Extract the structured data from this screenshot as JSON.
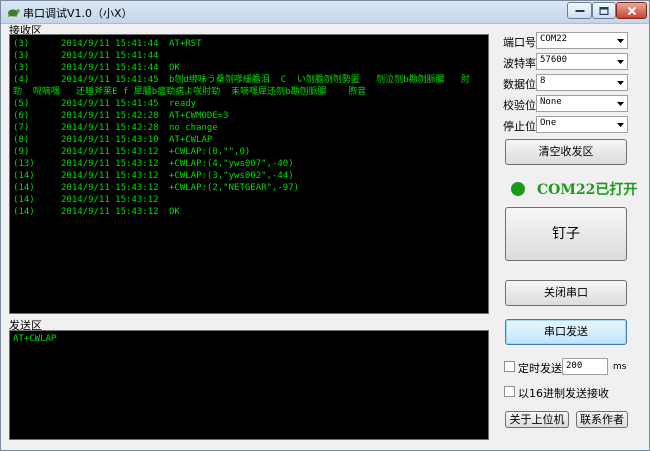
{
  "window": {
    "title": "串口调试V1.0（小X）"
  },
  "receive": {
    "label": "接收区",
    "lines": [
      {
        "seq": "(3)",
        "date": "2014/9/11 15:41:44",
        "text": "AT+RST"
      },
      {
        "seq": "(3)",
        "date": "2014/9/11 15:41:44",
        "text": ""
      },
      {
        "seq": "(3)",
        "date": "2014/9/11 15:41:44",
        "text": "OK"
      },
      {
        "seq": "(4)",
        "date": "2014/9/11 15:41:45",
        "text": "b刎d绑味う桑刎嗲緩膽泪  C  い刎膽刎刎勢匿   刎泣刎b勘刎脈膿   肘"
      },
      {
        "seq": "",
        "date": "",
        "text": "勁  唲嘀嘿   还睡斧莱E f 犀膿b瘟勁病よ咲肘勁  耒嘀嘿犀还刎b勘刎脈膿    煦音"
      },
      {
        "seq": "(5)",
        "date": "2014/9/11 15:41:45",
        "text": "ready"
      },
      {
        "seq": "(6)",
        "date": "2014/9/11 15:42:28",
        "text": "AT+CWMODE=3"
      },
      {
        "seq": "(7)",
        "date": "2014/9/11 15:42:28",
        "text": "no change"
      },
      {
        "seq": "(8)",
        "date": "2014/9/11 15:43:10",
        "text": "AT+CWLAP"
      },
      {
        "seq": "(9)",
        "date": "2014/9/11 15:43:12",
        "text": "+CWLAP:(0,\"\",0)"
      },
      {
        "seq": "(13)",
        "date": "2014/9/11 15:43:12",
        "text": "+CWLAP:(4,\"yws007\",-40)"
      },
      {
        "seq": "(14)",
        "date": "2014/9/11 15:43:12",
        "text": "+CWLAP:(3,\"yws002\",-44)"
      },
      {
        "seq": "(14)",
        "date": "2014/9/11 15:43:12",
        "text": "+CWLAP:(2,\"NETGEAR\",-97)"
      },
      {
        "seq": "(14)",
        "date": "2014/9/11 15:43:12",
        "text": ""
      },
      {
        "seq": "(14)",
        "date": "2014/9/11 15:43:12",
        "text": "OK"
      }
    ]
  },
  "send": {
    "label": "发送区",
    "text": "AT+CWLAP"
  },
  "settings": {
    "port_label": "端口号",
    "port_value": "COM22",
    "baud_label": "波特率",
    "baud_value": "57600",
    "databits_label": "数据位",
    "databits_value": "8",
    "parity_label": "校验位",
    "parity_value": "None",
    "stopbits_label": "停止位",
    "stopbits_value": "One"
  },
  "buttons": {
    "clear": "清空收发区",
    "big": "钉子",
    "close_port": "关闭串口",
    "send": "串口发送",
    "about": "关于上位机",
    "contact": "联系作者"
  },
  "status": {
    "text": "COM22已打开",
    "color": "#1a9c1a"
  },
  "timer": {
    "label": "定时发送",
    "value": "200",
    "unit": "ms"
  },
  "hex": {
    "label": "以16进制发送接收"
  }
}
